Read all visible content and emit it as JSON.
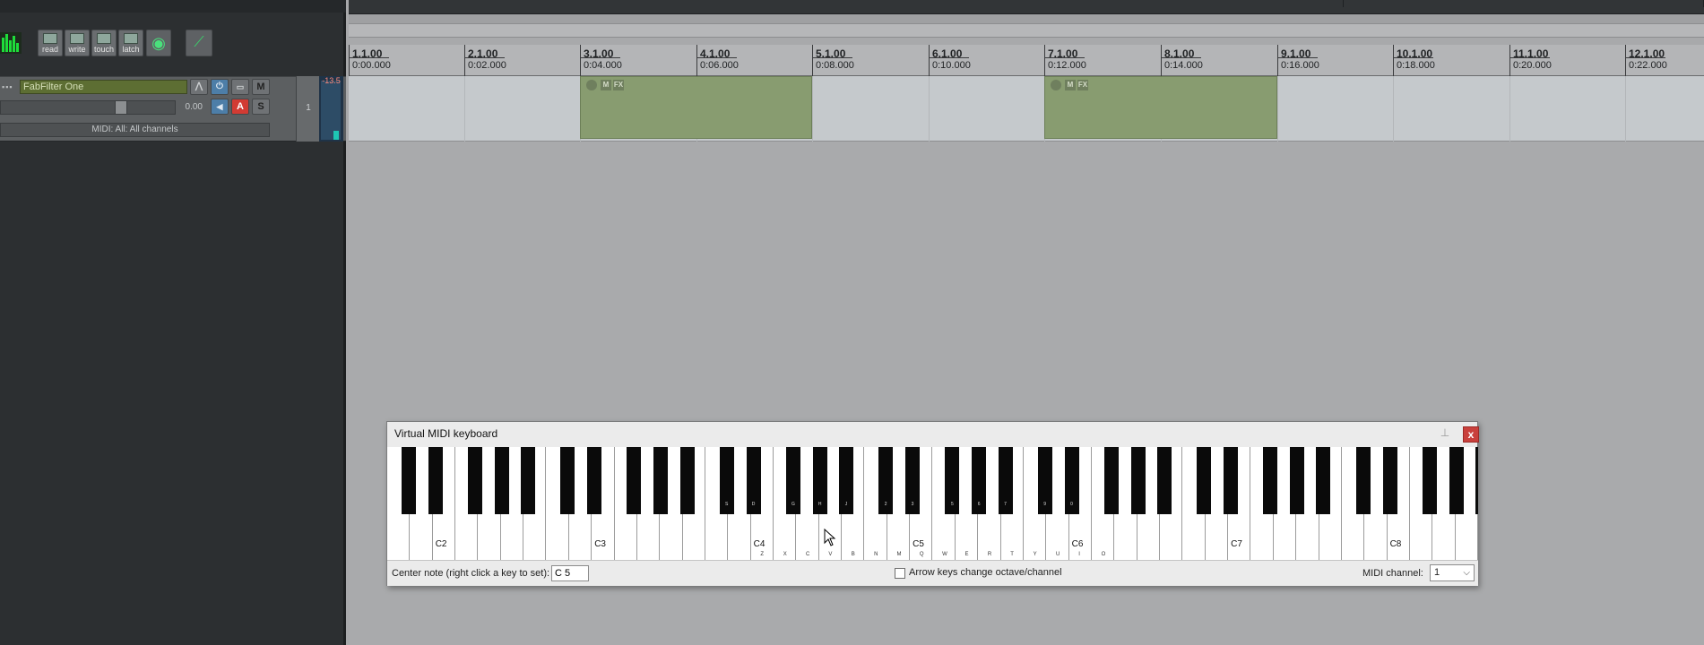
{
  "automation_buttons": [
    {
      "label": "read",
      "icon": "read-automation-icon"
    },
    {
      "label": "write",
      "icon": "write-automation-icon"
    },
    {
      "label": "touch",
      "icon": "touch-automation-icon"
    },
    {
      "label": "latch",
      "icon": "latch-automation-icon"
    }
  ],
  "track": {
    "name": "FabFilter One",
    "volume": "0.00",
    "midi_input": "MIDI: All: All channels",
    "number": "1",
    "peak": "-13.5",
    "mute_label": "M",
    "solo_label": "S",
    "arm_label": "A"
  },
  "ruler": [
    {
      "bar": "1.1.00",
      "time": "0:00.000"
    },
    {
      "bar": "2.1.00",
      "time": "0:02.000"
    },
    {
      "bar": "3.1.00",
      "time": "0:04.000"
    },
    {
      "bar": "4.1.00",
      "time": "0:06.000"
    },
    {
      "bar": "5.1.00",
      "time": "0:08.000"
    },
    {
      "bar": "6.1.00",
      "time": "0:10.000"
    },
    {
      "bar": "7.1.00",
      "time": "0:12.000"
    },
    {
      "bar": "8.1.00",
      "time": "0:14.000"
    },
    {
      "bar": "9.1.00",
      "time": "0:16.000"
    },
    {
      "bar": "10.1.00",
      "time": "0:18.000"
    },
    {
      "bar": "11.1.00",
      "time": "0:20.000"
    },
    {
      "bar": "12.1.00",
      "time": "0:22.000"
    }
  ],
  "items": [
    {
      "mute": "M",
      "fx": "FX"
    },
    {
      "mute": "M",
      "fx": "FX"
    }
  ],
  "vmk": {
    "title": "Virtual MIDI keyboard",
    "close": "x",
    "octave_labels": [
      "C2",
      "C3",
      "C4",
      "C5",
      "C6",
      "C7",
      "C8"
    ],
    "lower_keys": [
      "Z",
      "X",
      "C",
      "V",
      "B",
      "N",
      "M",
      "Q",
      "W",
      "E",
      "R",
      "T",
      "Y",
      "U",
      "I",
      "O"
    ],
    "upper_keys": [
      "S",
      "D",
      "G",
      "H",
      "J",
      "2",
      "3",
      "5",
      "6",
      "7",
      "9",
      "0"
    ],
    "center_note_label": "Center note (right click a key to set):",
    "center_note_value": "C 5",
    "arrow_keys_label": "Arrow keys change octave/channel",
    "midi_channel_label": "MIDI channel:",
    "midi_channel_value": "1"
  }
}
